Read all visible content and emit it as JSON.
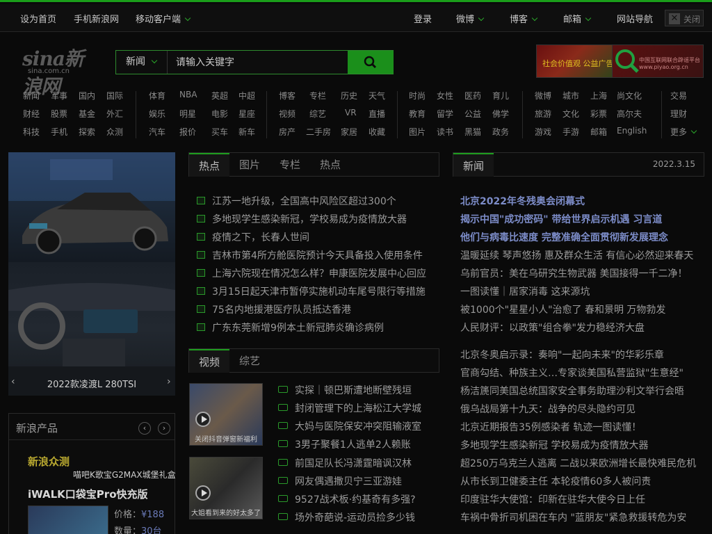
{
  "topbar": {
    "left": [
      "设为首页",
      "手机新浪网",
      "移动客户端"
    ],
    "right": [
      "登录",
      "微博",
      "博客",
      "邮箱",
      "网站导航"
    ],
    "close_label": "关闭"
  },
  "logo": {
    "text": "sina新浪网",
    "sub": "sina.com.cn"
  },
  "search": {
    "category": "新闻",
    "placeholder": "请输入关键字"
  },
  "ads": {
    "ad1": "社会价值观 公益广告",
    "ad2": "中国互联网联合辟谣平台 www.piyao.org.cn"
  },
  "nav": {
    "col1": [
      [
        "新闻",
        "军事",
        "国内",
        "国际"
      ],
      [
        "财经",
        "股票",
        "基金",
        "外汇"
      ],
      [
        "科技",
        "手机",
        "探索",
        "众测"
      ]
    ],
    "col2": [
      [
        "体育",
        "NBA",
        "英超",
        "中超"
      ],
      [
        "娱乐",
        "明星",
        "电影",
        "星座"
      ],
      [
        "汽车",
        "报价",
        "买车",
        "新车"
      ]
    ],
    "col3": [
      [
        "博客",
        "专栏",
        "历史",
        "天气"
      ],
      [
        "视频",
        "综艺",
        "VR",
        "直播"
      ],
      [
        "房产",
        "二手房",
        "家居",
        "收藏"
      ]
    ],
    "col4": [
      [
        "时尚",
        "女性",
        "医药",
        "育儿"
      ],
      [
        "教育",
        "留学",
        "公益",
        "佛学"
      ],
      [
        "图片",
        "读书",
        "黑猫",
        "政务"
      ]
    ],
    "col5": [
      [
        "微博",
        "城市",
        "上海",
        "尚文化"
      ],
      [
        "旅游",
        "文化",
        "彩票",
        "高尔夫"
      ],
      [
        "游戏",
        "手游",
        "邮箱",
        "English"
      ]
    ],
    "col6": [
      "交易",
      "理财",
      "更多"
    ]
  },
  "slider": {
    "caption": "2022款凌渡L 280TSI"
  },
  "news_tabs": [
    "热点",
    "图片",
    "专栏",
    "热点"
  ],
  "headlines": [
    "江苏一地升级，全国高中风险区超过300个",
    "多地现学生感染新冠，学校易成为疫情放大器",
    "疫情之下，长春人世间",
    "吉林市第4所方舱医院预计今天具备投入使用条件",
    "上海六院现在情况怎么样？申康医院发展中心回应",
    "3月15日起天津市暂停实施机动车尾号限行等措施",
    "75名内地援港医疗队员抵达香港",
    "广东东莞新增9例本土新冠肺炎确诊病例"
  ],
  "video_tabs": [
    "视频",
    "综艺"
  ],
  "videos": [
    {
      "caption": "关闭抖音弹窗新福利"
    },
    {
      "caption": "大姐看到来的好太多了"
    }
  ],
  "video_list": [
    "实探｜顿巴斯遭地断壁残垣",
    "封闭管理下的上海松江大学城",
    "大妈与医院保安冲突阻输液室",
    "3男子聚餐1人逃单2人赖账",
    "前国足队长冯潇霆暗讽汉林",
    "网友偶遇撒贝宁三亚游娃",
    "9527战术板·约基奇有多强?",
    "场外奇葩说-运动员捡多少钱"
  ],
  "right_tab": "新闻",
  "date": "2022.3.15",
  "news": [
    {
      "t": "北京2022年冬残奥会闭幕式",
      "b": true
    },
    {
      "t": "揭示中国\"成功密码\" 带给世界启示机遇 习言道",
      "b": true
    },
    {
      "t": "他们与病毒比速度 完整准确全面贯彻新发展理念",
      "b": true
    },
    {
      "t": "温暖延续 琴声悠扬 惠及群众生活 有信心必然迎来春天",
      "b": false
    },
    {
      "t": "乌前官员：美在乌研究生物武器 美国接得一千二净！",
      "b": false
    },
    {
      "t": "一图读懂｜居家消毒 这来源坑",
      "b": false
    },
    {
      "t": "被1000个\"星星小人\"治愈了 春和景明 万物勃发",
      "b": false
    },
    {
      "t": "人民财评：以政策\"组合拳\"发力稳经济大盘",
      "b": false
    },
    {
      "t": "北京冬奥启示录：奏响\"一起向未来\"的华彩乐章",
      "b": false
    },
    {
      "t": "官商勾结、种族主义…专家谈美国私营监狱\"生意经\"",
      "b": false
    },
    {
      "t": "杨洁篪同美国总统国家安全事务助理沙利文举行会晤",
      "b": false
    },
    {
      "t": "俄乌战局第十九天：战争的尽头隐约可见",
      "b": false
    },
    {
      "t": "北京近期报告35例感染者 轨迹一图读懂！",
      "b": false
    },
    {
      "t": "多地现学生感染新冠 学校易成为疫情放大器",
      "b": false
    },
    {
      "t": "超250万乌克兰人逃离 二战以来欧洲增长最快难民危机",
      "b": false
    },
    {
      "t": "从市长到卫健委主任 本轮疫情60多人被问责",
      "b": false
    },
    {
      "t": "印度驻华大使馆：印新在驻华大使今日上任",
      "b": false
    },
    {
      "t": "车祸中骨折司机困在车内 \"蓝朋友\"紧急救援转危为安",
      "b": false
    }
  ],
  "products": {
    "header": "新浪产品",
    "brand": "新浪众测",
    "promo": "喵吧K歌宝G2MAX城堡礼盒",
    "item_title": "iWALK口袋宝Pro快充版",
    "price_label": "价格：",
    "price": "¥188",
    "qty_label": "数量：",
    "qty": "30台"
  },
  "colors": {
    "accent": "#1a9e1a",
    "link_blue": "#7c8cc8",
    "bg": "#0a0a0a"
  }
}
